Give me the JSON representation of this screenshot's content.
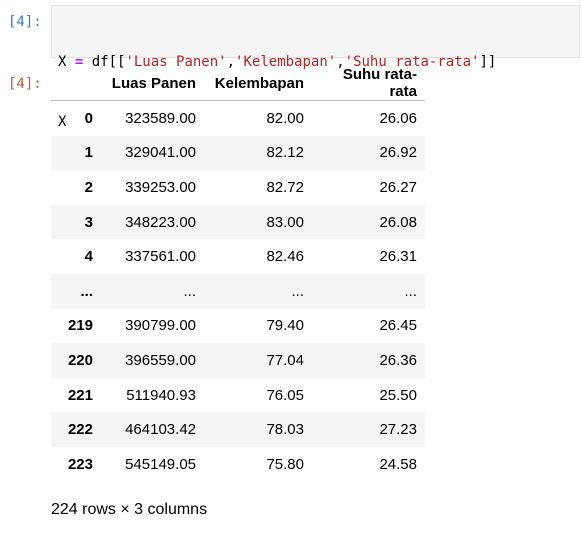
{
  "input_prompt": "[4]:",
  "output_prompt": "[4]:",
  "code": {
    "line1": [
      {
        "t": "name",
        "v": "X "
      },
      {
        "t": "op",
        "v": "="
      },
      {
        "t": "name",
        "v": " df[["
      },
      {
        "t": "str",
        "v": "'Luas Panen'"
      },
      {
        "t": "name",
        "v": ","
      },
      {
        "t": "str",
        "v": "'Kelembapan'"
      },
      {
        "t": "name",
        "v": ","
      },
      {
        "t": "str",
        "v": "'Suhu rata-rata'"
      },
      {
        "t": "name",
        "v": "]]"
      }
    ],
    "line2": "X"
  },
  "table": {
    "columns": [
      "",
      "Luas Panen",
      "Kelembapan",
      "Suhu rata-rata"
    ],
    "rows": [
      [
        "0",
        "323589.00",
        "82.00",
        "26.06"
      ],
      [
        "1",
        "329041.00",
        "82.12",
        "26.92"
      ],
      [
        "2",
        "339253.00",
        "82.72",
        "26.27"
      ],
      [
        "3",
        "348223.00",
        "83.00",
        "26.08"
      ],
      [
        "4",
        "337561.00",
        "82.46",
        "26.31"
      ],
      [
        "...",
        "...",
        "...",
        "..."
      ],
      [
        "219",
        "390799.00",
        "79.40",
        "26.45"
      ],
      [
        "220",
        "396559.00",
        "77.04",
        "26.36"
      ],
      [
        "221",
        "511940.93",
        "76.05",
        "25.50"
      ],
      [
        "222",
        "464103.42",
        "78.03",
        "27.23"
      ],
      [
        "223",
        "545149.05",
        "75.80",
        "24.58"
      ]
    ]
  },
  "footer": "224 rows × 3 columns"
}
